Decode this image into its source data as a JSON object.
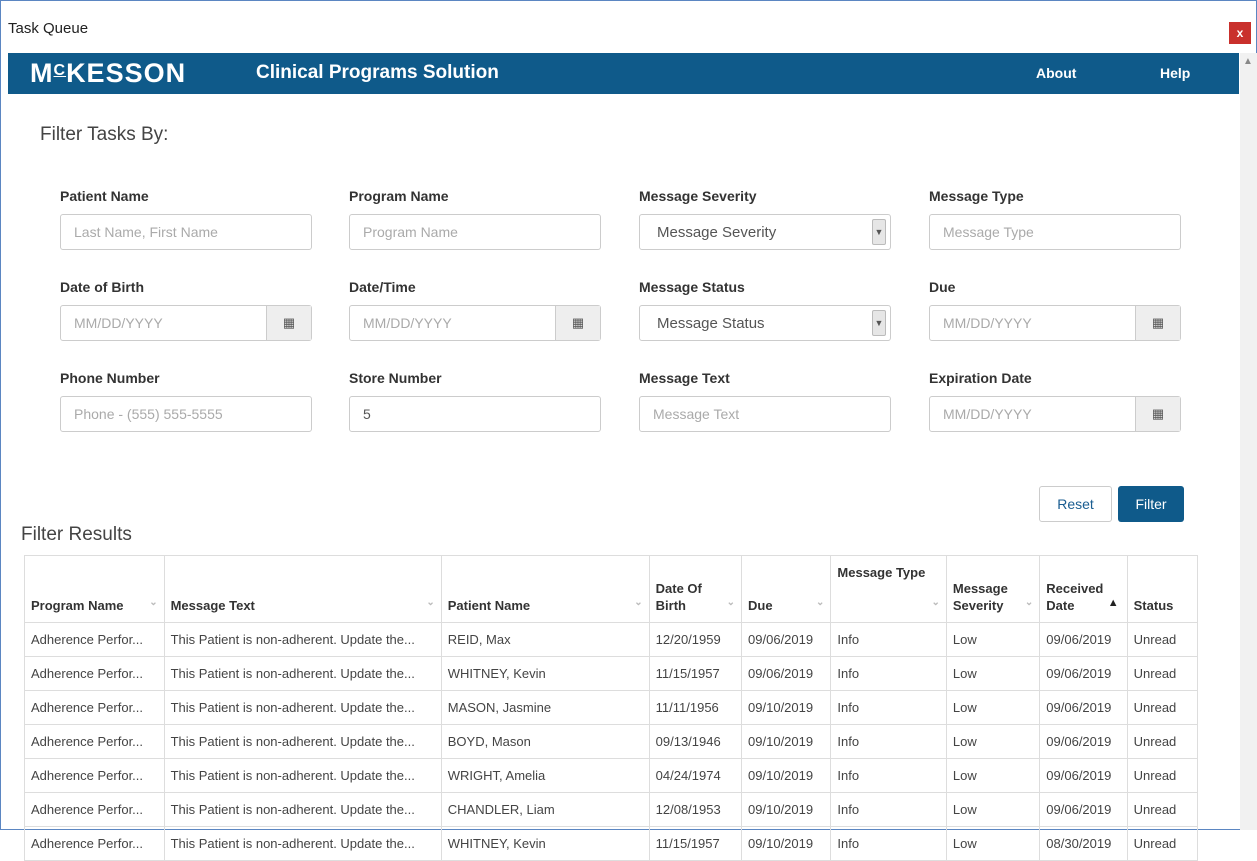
{
  "window": {
    "title": "Task Queue",
    "close_label": "x"
  },
  "header": {
    "logo_main": "MCKESSON",
    "app_title": "Clinical Programs Solution",
    "nav": {
      "about": "About",
      "help": "Help"
    }
  },
  "filter": {
    "heading": "Filter Tasks By:",
    "patient_name": {
      "label": "Patient Name",
      "placeholder": "Last Name, First Name"
    },
    "program_name": {
      "label": "Program Name",
      "placeholder": "Program Name"
    },
    "message_severity": {
      "label": "Message Severity",
      "selected": "Message Severity"
    },
    "message_type": {
      "label": "Message Type",
      "placeholder": "Message Type"
    },
    "date_of_birth": {
      "label": "Date of Birth",
      "placeholder": "MM/DD/YYYY"
    },
    "date_time": {
      "label": "Date/Time",
      "placeholder": "MM/DD/YYYY"
    },
    "message_status": {
      "label": "Message Status",
      "selected": "Message Status"
    },
    "due": {
      "label": "Due",
      "placeholder": "MM/DD/YYYY"
    },
    "phone_number": {
      "label": "Phone Number",
      "placeholder": "Phone - (555) 555-5555"
    },
    "store_number": {
      "label": "Store Number",
      "value": "5"
    },
    "message_text": {
      "label": "Message Text",
      "placeholder": "Message Text"
    },
    "expiration_date": {
      "label": "Expiration Date",
      "placeholder": "MM/DD/YYYY"
    },
    "reset_label": "Reset",
    "filter_label": "Filter"
  },
  "results": {
    "heading": "Filter Results",
    "columns": {
      "program_name": "Program Name",
      "message_text": "Message Text",
      "patient_name": "Patient Name",
      "dob_1": "Date Of",
      "dob_2": "Birth",
      "due": "Due",
      "message_type": "Message Type",
      "severity_1": "Message",
      "severity_2": "Severity",
      "received_1": "Received",
      "received_2": "Date",
      "status": "Status"
    },
    "rows": [
      {
        "program": "Adherence Perfor...",
        "text": "This Patient is non-adherent. Update the...",
        "patient": "REID, Max",
        "dob": "12/20/1959",
        "due": "09/06/2019",
        "type": "Info",
        "severity": "Low",
        "received": "09/06/2019",
        "status": "Unread"
      },
      {
        "program": "Adherence Perfor...",
        "text": "This Patient is non-adherent. Update the...",
        "patient": "WHITNEY, Kevin",
        "dob": "11/15/1957",
        "due": "09/06/2019",
        "type": "Info",
        "severity": "Low",
        "received": "09/06/2019",
        "status": "Unread"
      },
      {
        "program": "Adherence Perfor...",
        "text": "This Patient is non-adherent. Update the...",
        "patient": "MASON, Jasmine",
        "dob": "11/11/1956",
        "due": "09/10/2019",
        "type": "Info",
        "severity": "Low",
        "received": "09/06/2019",
        "status": "Unread"
      },
      {
        "program": "Adherence Perfor...",
        "text": "This Patient is non-adherent. Update the...",
        "patient": "BOYD, Mason",
        "dob": "09/13/1946",
        "due": "09/10/2019",
        "type": "Info",
        "severity": "Low",
        "received": "09/06/2019",
        "status": "Unread"
      },
      {
        "program": "Adherence Perfor...",
        "text": "This Patient is non-adherent. Update the...",
        "patient": "WRIGHT, Amelia",
        "dob": "04/24/1974",
        "due": "09/10/2019",
        "type": "Info",
        "severity": "Low",
        "received": "09/06/2019",
        "status": "Unread"
      },
      {
        "program": "Adherence Perfor...",
        "text": "This Patient is non-adherent. Update the...",
        "patient": "CHANDLER, Liam",
        "dob": "12/08/1953",
        "due": "09/10/2019",
        "type": "Info",
        "severity": "Low",
        "received": "09/06/2019",
        "status": "Unread"
      },
      {
        "program": "Adherence Perfor...",
        "text": "This Patient is non-adherent. Update the...",
        "patient": "WHITNEY, Kevin",
        "dob": "11/15/1957",
        "due": "09/10/2019",
        "type": "Info",
        "severity": "Low",
        "received": "08/30/2019",
        "status": "Unread"
      }
    ]
  },
  "colors": {
    "brand": "#0f5a8a",
    "close": "#c9302c"
  },
  "icons": {
    "calendar": "calendar-icon",
    "caret": "caret-down-icon",
    "sort": "sort-ascending-icon"
  }
}
